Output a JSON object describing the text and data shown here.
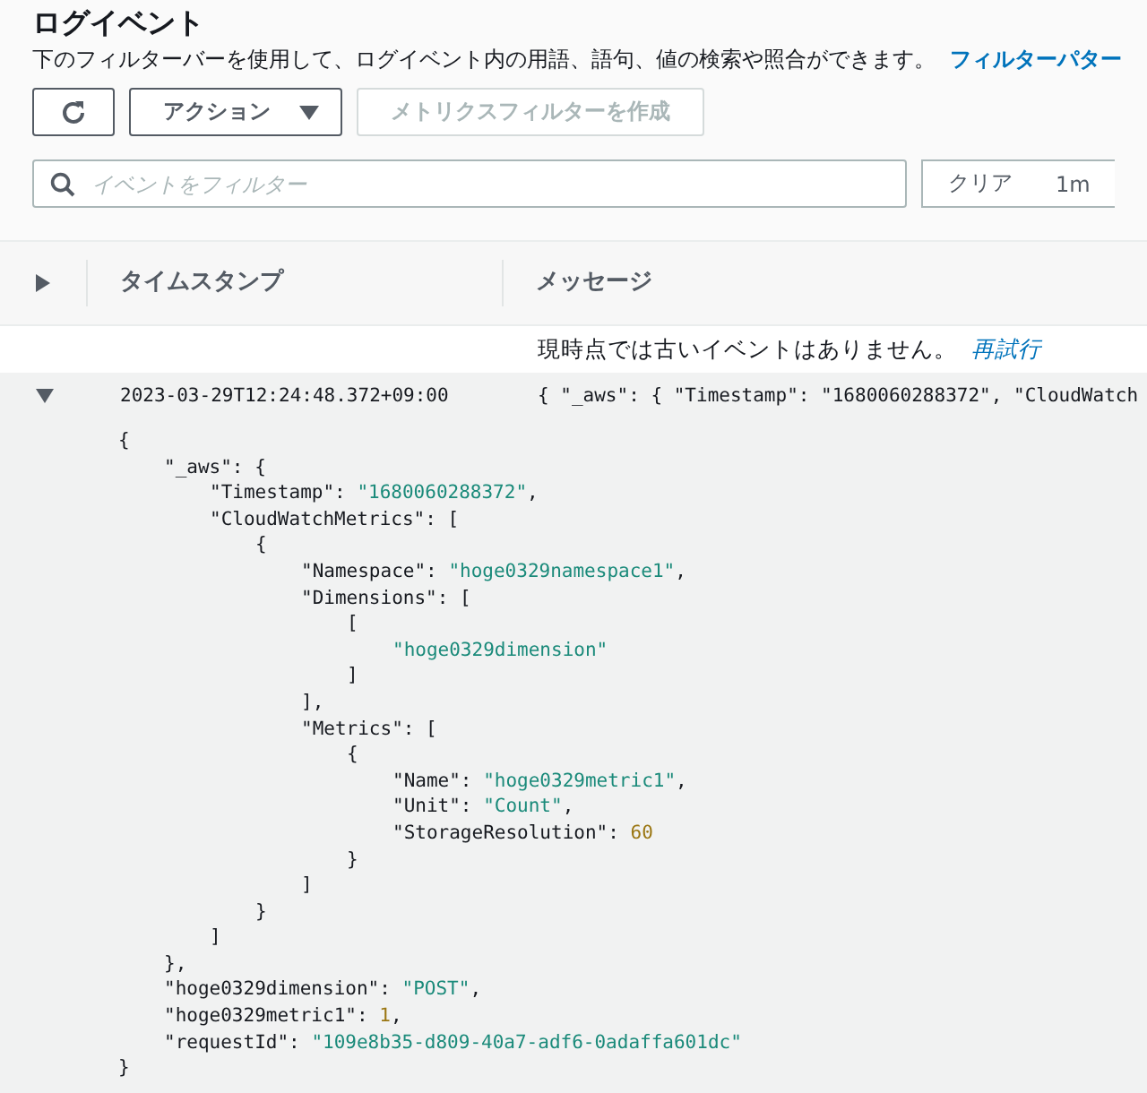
{
  "header": {
    "title": "ログイベント",
    "description": "下のフィルターバーを使用して、ログイベント内の用語、語句、値の検索や照合ができます。",
    "link": "フィルターパター"
  },
  "buttons": [
    {
      "kind": "refresh",
      "disabled": false
    },
    {
      "kind": "dropdown",
      "label": "アクション",
      "disabled": false
    },
    {
      "kind": "plain",
      "label": "メトリクスフィルターを作成",
      "disabled": true
    }
  ],
  "search": {
    "placeholder": "イベントをフィルター"
  },
  "time_range": [
    {
      "label": "クリア"
    },
    {
      "label": "1m"
    }
  ],
  "table": {
    "columns": [
      "タイムスタンプ",
      "メッセージ"
    ],
    "notice": {
      "text": "現時点では古いイベントはありません。",
      "link": "再試行"
    },
    "rows": [
      {
        "expanded": true,
        "timestamp": "2023-03-29T12:24:48.372+09:00",
        "message": "{ \"_aws\": { \"Timestamp\": \"1680060288372\", \"CloudWatch",
        "detail": [
          {
            "tokens": [
              {
                "kind": "plain",
                "text": "{"
              }
            ],
            "children": [
              {
                "tokens": [
                  {
                    "kind": "plain",
                    "text": "\"_aws\": {"
                  }
                ],
                "children": [
                  {
                    "tokens": [
                      {
                        "kind": "plain",
                        "text": "\"Timestamp\": "
                      },
                      {
                        "kind": "string",
                        "text": "\"1680060288372\""
                      },
                      {
                        "kind": "plain",
                        "text": ","
                      }
                    ]
                  },
                  {
                    "tokens": [
                      {
                        "kind": "plain",
                        "text": "\"CloudWatchMetrics\": ["
                      }
                    ],
                    "children": [
                      {
                        "tokens": [
                          {
                            "kind": "plain",
                            "text": "{"
                          }
                        ],
                        "children": [
                          {
                            "tokens": [
                              {
                                "kind": "plain",
                                "text": "\"Namespace\": "
                              },
                              {
                                "kind": "string",
                                "text": "\"hoge0329namespace1\""
                              },
                              {
                                "kind": "plain",
                                "text": ","
                              }
                            ]
                          },
                          {
                            "tokens": [
                              {
                                "kind": "plain",
                                "text": "\"Dimensions\": ["
                              }
                            ],
                            "children": [
                              {
                                "tokens": [
                                  {
                                    "kind": "plain",
                                    "text": "["
                                  }
                                ],
                                "children": [
                                  {
                                    "tokens": [
                                      {
                                        "kind": "string",
                                        "text": "\"hoge0329dimension\""
                                      }
                                    ]
                                  }
                                ]
                              },
                              {
                                "tokens": [
                                  {
                                    "kind": "plain",
                                    "text": "]"
                                  }
                                ]
                              }
                            ]
                          },
                          {
                            "tokens": [
                              {
                                "kind": "plain",
                                "text": "],"
                              }
                            ]
                          },
                          {
                            "tokens": [
                              {
                                "kind": "plain",
                                "text": "\"Metrics\": ["
                              }
                            ],
                            "children": [
                              {
                                "tokens": [
                                  {
                                    "kind": "plain",
                                    "text": "{"
                                  }
                                ],
                                "children": [
                                  {
                                    "tokens": [
                                      {
                                        "kind": "plain",
                                        "text": "\"Name\": "
                                      },
                                      {
                                        "kind": "string",
                                        "text": "\"hoge0329metric1\""
                                      },
                                      {
                                        "kind": "plain",
                                        "text": ","
                                      }
                                    ]
                                  },
                                  {
                                    "tokens": [
                                      {
                                        "kind": "plain",
                                        "text": "\"Unit\": "
                                      },
                                      {
                                        "kind": "string",
                                        "text": "\"Count\""
                                      },
                                      {
                                        "kind": "plain",
                                        "text": ","
                                      }
                                    ]
                                  },
                                  {
                                    "tokens": [
                                      {
                                        "kind": "plain",
                                        "text": "\"StorageResolution\": "
                                      },
                                      {
                                        "kind": "number",
                                        "text": "60"
                                      }
                                    ]
                                  }
                                ]
                              },
                              {
                                "tokens": [
                                  {
                                    "kind": "plain",
                                    "text": "}"
                                  }
                                ]
                              }
                            ]
                          },
                          {
                            "tokens": [
                              {
                                "kind": "plain",
                                "text": "]"
                              }
                            ]
                          }
                        ]
                      },
                      {
                        "tokens": [
                          {
                            "kind": "plain",
                            "text": "}"
                          }
                        ]
                      }
                    ]
                  },
                  {
                    "tokens": [
                      {
                        "kind": "plain",
                        "text": "]"
                      }
                    ]
                  }
                ]
              },
              {
                "tokens": [
                  {
                    "kind": "plain",
                    "text": "},"
                  }
                ]
              },
              {
                "tokens": [
                  {
                    "kind": "plain",
                    "text": "\"hoge0329dimension\": "
                  },
                  {
                    "kind": "string",
                    "text": "\"POST\""
                  },
                  {
                    "kind": "plain",
                    "text": ","
                  }
                ]
              },
              {
                "tokens": [
                  {
                    "kind": "plain",
                    "text": "\"hoge0329metric1\": "
                  },
                  {
                    "kind": "number",
                    "text": "1"
                  },
                  {
                    "kind": "plain",
                    "text": ","
                  }
                ]
              },
              {
                "tokens": [
                  {
                    "kind": "plain",
                    "text": "\"requestId\": "
                  },
                  {
                    "kind": "string",
                    "text": "\"109e8b35-d809-40a7-adf6-0adaffa601dc\""
                  }
                ]
              }
            ]
          },
          {
            "tokens": [
              {
                "kind": "plain",
                "text": "}"
              }
            ]
          }
        ]
      }
    ]
  }
}
